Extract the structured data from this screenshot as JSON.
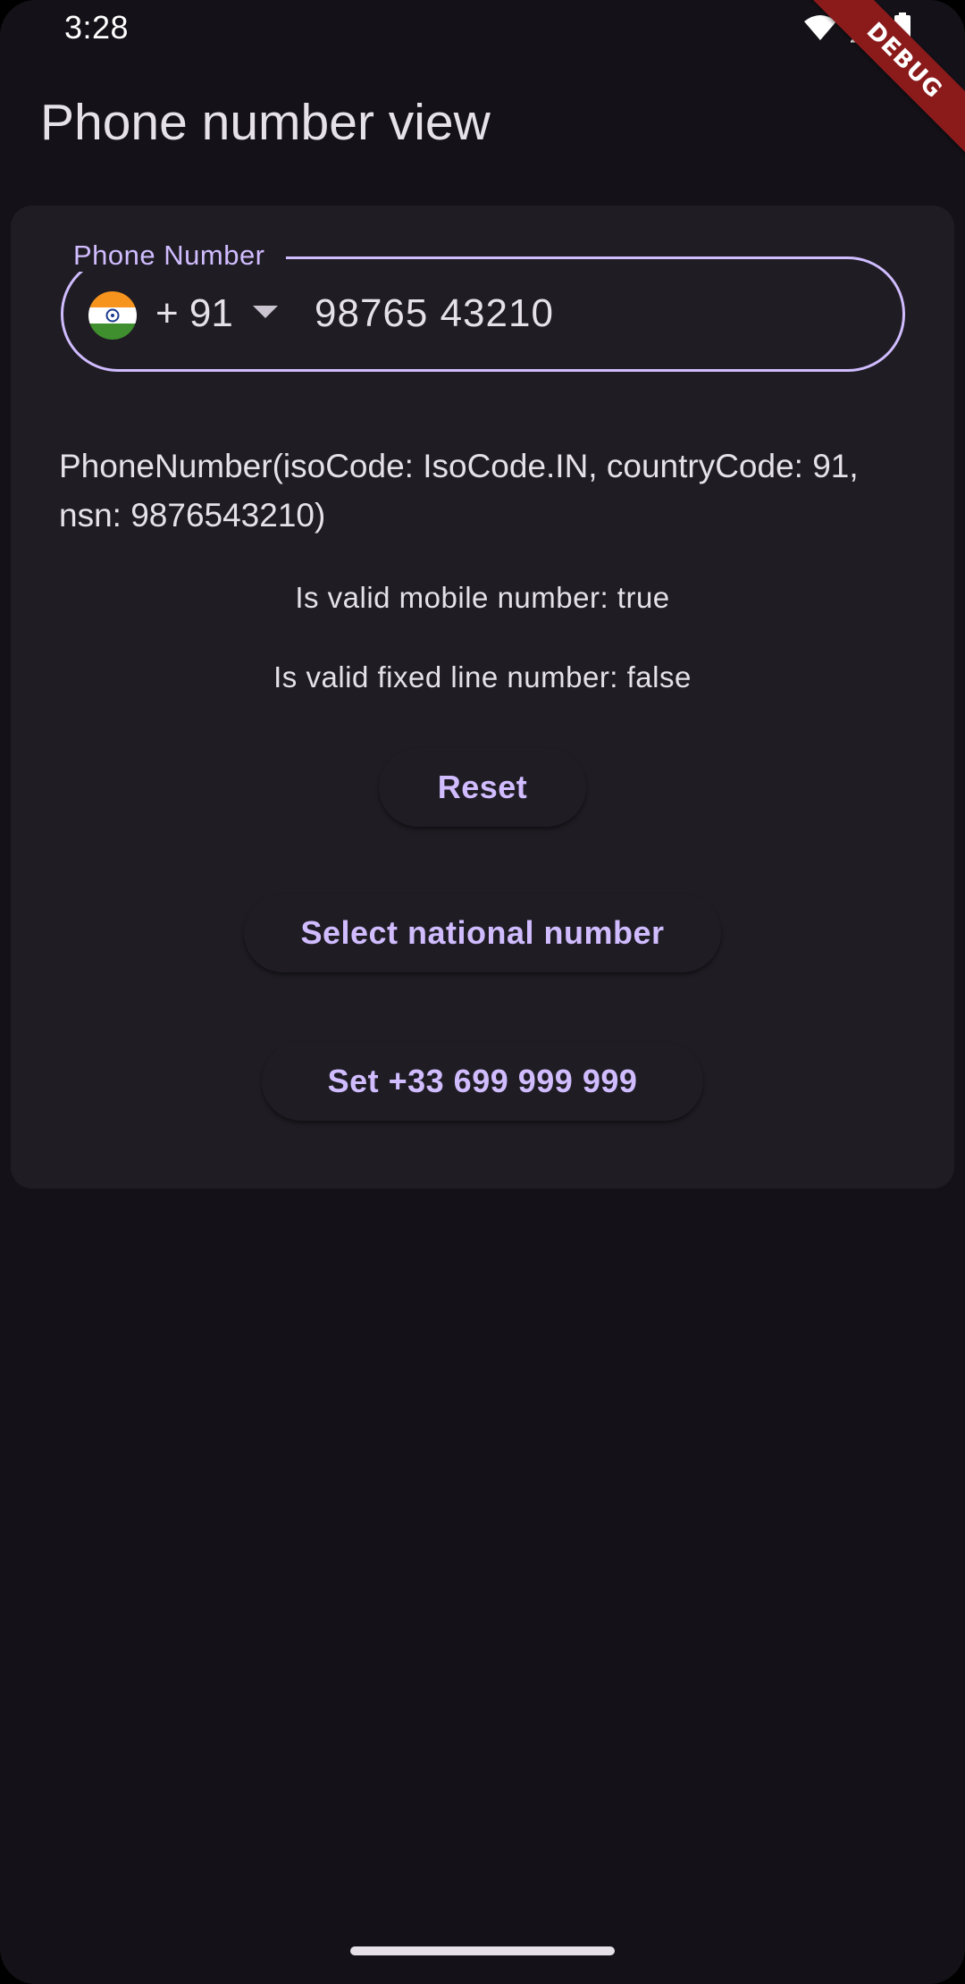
{
  "status_bar": {
    "time": "3:28",
    "icons": [
      "wifi-icon",
      "signal-icon",
      "battery-icon"
    ]
  },
  "debug_banner": "DEBUG",
  "app_bar": {
    "title": "Phone number view"
  },
  "phone_field": {
    "label": "Phone Number",
    "flag": "india-flag-icon",
    "country_code": "+ 91",
    "value": "98765 43210"
  },
  "result": {
    "phone_number_text": "PhoneNumber(isoCode: IsoCode.IN, countryCode: 91, nsn: 9876543210)",
    "valid_mobile": "Is valid mobile number: true",
    "valid_fixed_line": "Is valid fixed line number: false"
  },
  "buttons": {
    "reset": "Reset",
    "select_national": "Select national number",
    "set_number": "Set +33 699 999 999"
  },
  "colors": {
    "background": "#141218",
    "card": "#1f1d23",
    "accent": "#d0bcff",
    "text": "#e6e0e9",
    "debug_banner": "#8b1a1a"
  }
}
